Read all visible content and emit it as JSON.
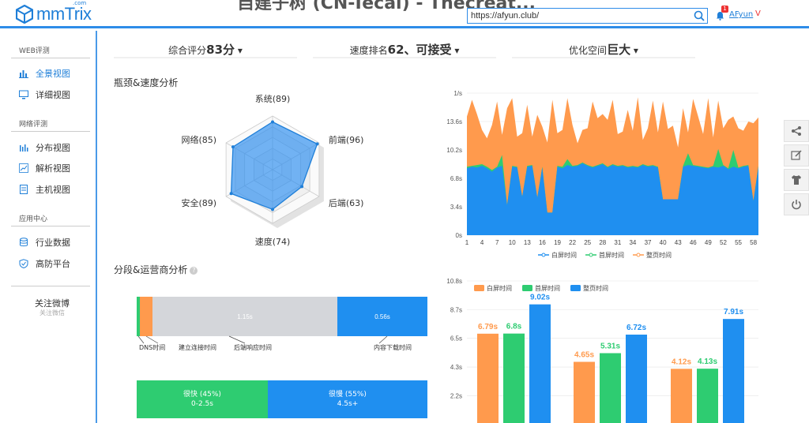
{
  "header": {
    "logo_text": "mmTrix",
    "logo_sup": ".com",
    "page_title": "自建子树 (CN-Tecal) - Thecreat...",
    "url_value": "https://afyun.club/",
    "notif_count": "1",
    "user_name": "AFyun",
    "vip_mark": "V"
  },
  "sidebar": {
    "sections": [
      {
        "title": "WEB评测",
        "items": [
          {
            "label": "全景视图",
            "active": true,
            "icon": "bar-chart-icon"
          },
          {
            "label": "详细视图",
            "active": false,
            "icon": "monitor-icon"
          }
        ]
      },
      {
        "title": "网络评测",
        "items": [
          {
            "label": "分布视图",
            "active": false,
            "icon": "bar-chart-icon"
          },
          {
            "label": "解析视图",
            "active": false,
            "icon": "line-chart-icon"
          },
          {
            "label": "主机视图",
            "active": false,
            "icon": "server-icon"
          }
        ]
      },
      {
        "title": "应用中心",
        "items": [
          {
            "label": "行业数据",
            "active": false,
            "icon": "database-icon"
          },
          {
            "label": "高防平台",
            "active": false,
            "icon": "shield-icon"
          }
        ]
      }
    ],
    "follow_label": "关注微博",
    "follow_sub": "关注微信"
  },
  "stats": {
    "score_label": "综合评分",
    "score_value": "83分",
    "rank_label": "速度排名",
    "rank_value": "62、可接受",
    "opt_label": "优化空间",
    "opt_value": "巨大"
  },
  "sections": {
    "radar_title": "瓶颈&速度分析",
    "segment_title": "分段&运营商分析",
    "help": "?"
  },
  "radar": {
    "axes": [
      {
        "label": "系统(89)",
        "value": 89
      },
      {
        "label": "前端(96)",
        "value": 96
      },
      {
        "label": "后端(63)",
        "value": 63
      },
      {
        "label": "速度(74)",
        "value": 74
      },
      {
        "label": "安全(89)",
        "value": 89
      },
      {
        "label": "网络(85)",
        "value": 85
      }
    ]
  },
  "chart_data": [
    {
      "type": "area",
      "yticks": [
        "1/s",
        "13.6s",
        "10.2s",
        "6.8s",
        "3.4s",
        "0s"
      ],
      "ylim": [
        0,
        17
      ],
      "xticks": [
        "1",
        "4",
        "7",
        "10",
        "13",
        "16",
        "19",
        "22",
        "25",
        "28",
        "31",
        "34",
        "37",
        "40",
        "43",
        "46",
        "49",
        "52",
        "55",
        "58"
      ],
      "legend": [
        "白屏时间",
        "首屏时间",
        "整页时间"
      ],
      "colors": [
        "#1f8ff0",
        "#2ecc71",
        "#ff9a4d"
      ],
      "series": [
        {
          "name": "白屏时间",
          "values": [
            8,
            8.2,
            8.1,
            8.3,
            8,
            7.6,
            8.1,
            8.3,
            3.6,
            8.2,
            8.1,
            4.6,
            8.2,
            8.3,
            4.5,
            8.1,
            2.7,
            2.7,
            8.2,
            8,
            8.4,
            8.2,
            8.3,
            8.6,
            8.3,
            8.1,
            8.3,
            8.5,
            8.1,
            8.4,
            8.2,
            8.3,
            8.1,
            8.2,
            8.1,
            8.4,
            8.2,
            8.3,
            8.1,
            4.3,
            4.3,
            4.3,
            4.3,
            8.2,
            8.4,
            8.3,
            8.2,
            8.1,
            8,
            8.2,
            8.1,
            8.3,
            7.9,
            8.2,
            8,
            8.2,
            8.3,
            4.1,
            8.2
          ]
        },
        {
          "name": "首屏时间",
          "values": [
            8.2,
            8.3,
            8.4,
            8.5,
            8.2,
            7.8,
            8.2,
            9.6,
            3.6,
            8.3,
            8.2,
            4.6,
            8.3,
            8.4,
            4.5,
            8.2,
            2.7,
            2.7,
            8.3,
            8.2,
            9.1,
            8.3,
            8.4,
            8.7,
            8.4,
            8.2,
            8.4,
            8.6,
            8.2,
            8.5,
            8.3,
            8.4,
            8.2,
            8.3,
            8.2,
            8.5,
            8.3,
            8.4,
            8.2,
            4.3,
            4.3,
            4.3,
            4.3,
            8.3,
            9.8,
            8.4,
            8.3,
            8.2,
            8.1,
            8.3,
            10.3,
            8.4,
            8,
            10.2,
            8.1,
            8.3,
            8.4,
            4.1,
            8.3
          ]
        },
        {
          "name": "整页时间",
          "values": [
            14.2,
            16.2,
            14.5,
            12.6,
            11.6,
            13.2,
            16,
            12,
            15.2,
            16.4,
            11.8,
            12.2,
            15.6,
            11.8,
            14.4,
            13,
            11.1,
            16.2,
            12.2,
            12.6,
            16.4,
            13.2,
            11,
            12.6,
            12.8,
            16,
            14,
            14.5,
            13.8,
            16.2,
            12.1,
            12.4,
            15,
            12.5,
            16.5,
            11.4,
            12.8,
            16.1,
            12.3,
            16,
            12.7,
            13.1,
            10.5,
            15.2,
            12.3,
            16.3,
            14.2,
            12.1,
            16.4,
            11.7,
            16.1,
            12.8,
            13.8,
            14.2,
            12.8,
            12.5,
            13.6,
            13.4,
            14.1
          ]
        }
      ]
    },
    {
      "type": "bar",
      "yticks": [
        "10.8s",
        "8.7s",
        "6.5s",
        "4.3s",
        "2.2s"
      ],
      "ylim": [
        0,
        10.8
      ],
      "legend": [
        "白屏时间",
        "首屏时间",
        "整页时间"
      ],
      "colors": [
        "#ff9a4d",
        "#2ecc71",
        "#1f8ff0"
      ],
      "groups": [
        {
          "values": [
            6.79,
            6.8,
            9.02
          ],
          "labels": [
            "6.79s",
            "6.8s",
            "9.02s"
          ]
        },
        {
          "values": [
            4.65,
            5.31,
            6.72
          ],
          "labels": [
            "4.65s",
            "5.31s",
            "6.72s"
          ]
        },
        {
          "values": [
            4.12,
            4.13,
            7.91
          ],
          "labels": [
            "4.12s",
            "4.13s",
            "7.91s"
          ]
        }
      ]
    }
  ],
  "segments": {
    "bar_values": {
      "connect": "1.15s",
      "download": "0.56s"
    },
    "labels": [
      "DNS时间",
      "建立连接时间",
      "后端响应时间",
      "内容下载时间"
    ],
    "fast": {
      "title": "很快 (45%)",
      "range": "0-2.5s"
    },
    "slow": {
      "title": "很慢 (55%)",
      "range": "4.5s+"
    }
  }
}
